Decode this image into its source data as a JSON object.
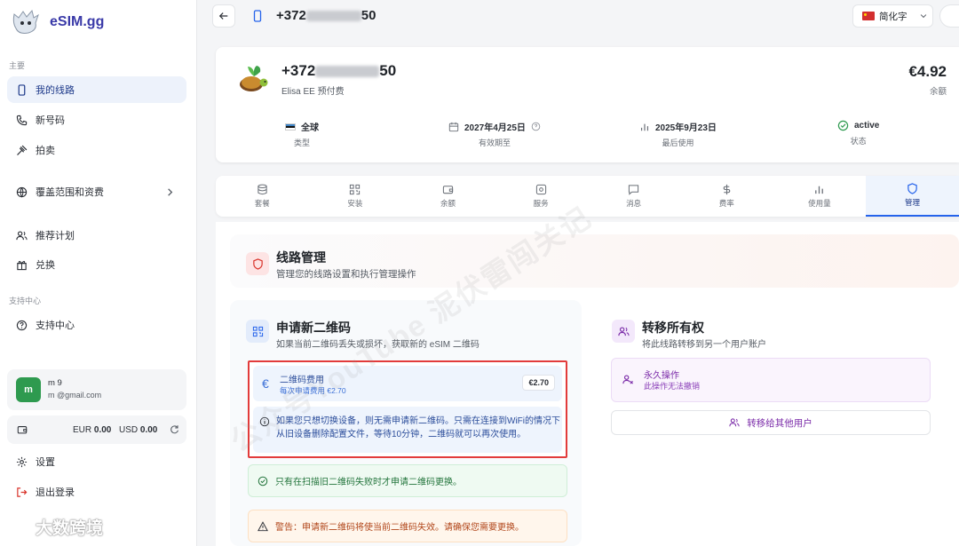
{
  "sidebar": {
    "brand": "eSIM.gg",
    "section_main": "主要",
    "items": [
      {
        "label": "我的线路"
      },
      {
        "label": "新号码"
      },
      {
        "label": "拍卖"
      },
      {
        "label": "覆盖范围和资费"
      },
      {
        "label": "推荐计划"
      },
      {
        "label": "兑换"
      }
    ],
    "section_support": "支持中心",
    "support_label": "支持中心",
    "user": {
      "avatar": "m",
      "name": "m        9",
      "email": "m         @gmail.com"
    },
    "balance": {
      "eur_label": "EUR",
      "eur_value": "0.00",
      "usd_label": "USD",
      "usd_value": "0.00"
    },
    "settings_label": "设置",
    "logout_label": "退出登录",
    "watermark": "大数跨境"
  },
  "topbar": {
    "number_prefix": "+372",
    "number_suffix": "50",
    "language": "简化字"
  },
  "line": {
    "number_prefix": "+372",
    "number_suffix": "50",
    "carrier": "Elisa EE 预付费",
    "amount": "€4.92",
    "amount_label": "余额",
    "stats": [
      {
        "value": "全球",
        "label": "类型"
      },
      {
        "value": "2027年4月25日",
        "label": "有效期至"
      },
      {
        "value": "2025年9月23日",
        "label": "最后使用"
      },
      {
        "value": "active",
        "label": "状态"
      }
    ]
  },
  "tabs": [
    "套餐",
    "安装",
    "余额",
    "服务",
    "消息",
    "费率",
    "使用量",
    "管理"
  ],
  "management": {
    "title": "线路管理",
    "subtitle": "管理您的线路设置和执行管理操作",
    "qr": {
      "title": "申请新二维码",
      "subtitle": "如果当前二维码丢失或损坏，获取新的 eSIM 二维码",
      "fee_title": "二维码费用",
      "fee_sub": "每次申请费用 €2.70",
      "fee_price": "€2.70",
      "info": "如果您只想切换设备，则无需申请新二维码。只需在连接到WiFi的情况下从旧设备删除配置文件，等待10分钟，二维码就可以再次使用。",
      "notice": "只有在扫描旧二维码失败时才申请二维码更换。",
      "warning": "警告：申请新二维码将使当前二维码失效。请确保您需要更换。"
    },
    "transfer": {
      "title": "转移所有权",
      "subtitle": "将此线路转移到另一个用户账户",
      "perm_title": "永久操作",
      "perm_sub": "此操作无法撤销",
      "button": "转移给其他用户"
    }
  },
  "overlay_watermark": "公众号YouTube 泥伏雷闯关记",
  "colors": {
    "accent": "#2563eb",
    "brand": "#3a3aa8",
    "highlight_border": "#e23b3b",
    "success": "#2e9a4f"
  }
}
